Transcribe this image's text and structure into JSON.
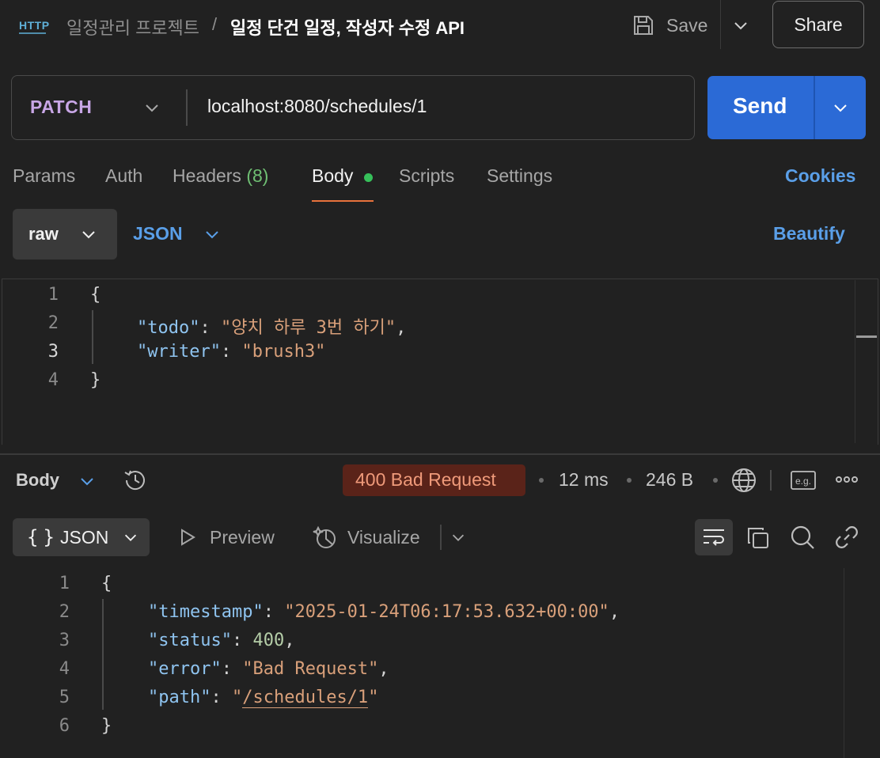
{
  "header": {
    "icon": "http-icon",
    "icon_text": "HTTP",
    "breadcrumb_parent": "일정관리 프로젝트",
    "breadcrumb_separator": "/",
    "request_title": "일정 단건 일정, 작성자 수정 API",
    "save_label": "Save",
    "share_label": "Share"
  },
  "request": {
    "method": "PATCH",
    "url": "localhost:8080/schedules/1",
    "send_label": "Send"
  },
  "tabs": {
    "params": "Params",
    "auth": "Auth",
    "headers": "Headers",
    "headers_count": "(8)",
    "body": "Body",
    "scripts": "Scripts",
    "settings": "Settings",
    "cookies": "Cookies",
    "active": "Body"
  },
  "body_options": {
    "mode": "raw",
    "format": "JSON",
    "beautify_label": "Beautify"
  },
  "request_body": {
    "line_numbers": [
      "1",
      "2",
      "3",
      "4"
    ],
    "open_brace": "{",
    "todo_key": "\"todo\"",
    "todo_value": "\"양치 하루 3번 하기\"",
    "writer_key": "\"writer\"",
    "writer_value": "\"brush3\"",
    "close_brace": "}"
  },
  "response_bar": {
    "body_label": "Body",
    "status": "400 Bad Request",
    "time": "12 ms",
    "size": "246 B",
    "example_label": "e.g."
  },
  "response_view": {
    "format": "JSON",
    "braces": "{}",
    "preview_label": "Preview",
    "visualize_label": "Visualize"
  },
  "response_body": {
    "line_numbers": [
      "1",
      "2",
      "3",
      "4",
      "5",
      "6"
    ],
    "open_brace": "{",
    "timestamp_key": "\"timestamp\"",
    "timestamp_value": "\"2025-01-24T06:17:53.632+00:00\"",
    "status_key": "\"status\"",
    "status_value": "400",
    "error_key": "\"error\"",
    "error_value": "\"Bad Request\"",
    "path_key": "\"path\"",
    "path_value": "/schedules/1",
    "close_brace": "}"
  },
  "colors": {
    "background": "#212121",
    "send_button": "#2b6ad6",
    "method_color": "#c8a6e6",
    "link_blue": "#5a9fe8",
    "status_badge_bg": "#5a2319",
    "status_badge_text": "#ef9a7a",
    "active_tab_underline": "#e8723c",
    "body_dot": "#36c05a"
  }
}
